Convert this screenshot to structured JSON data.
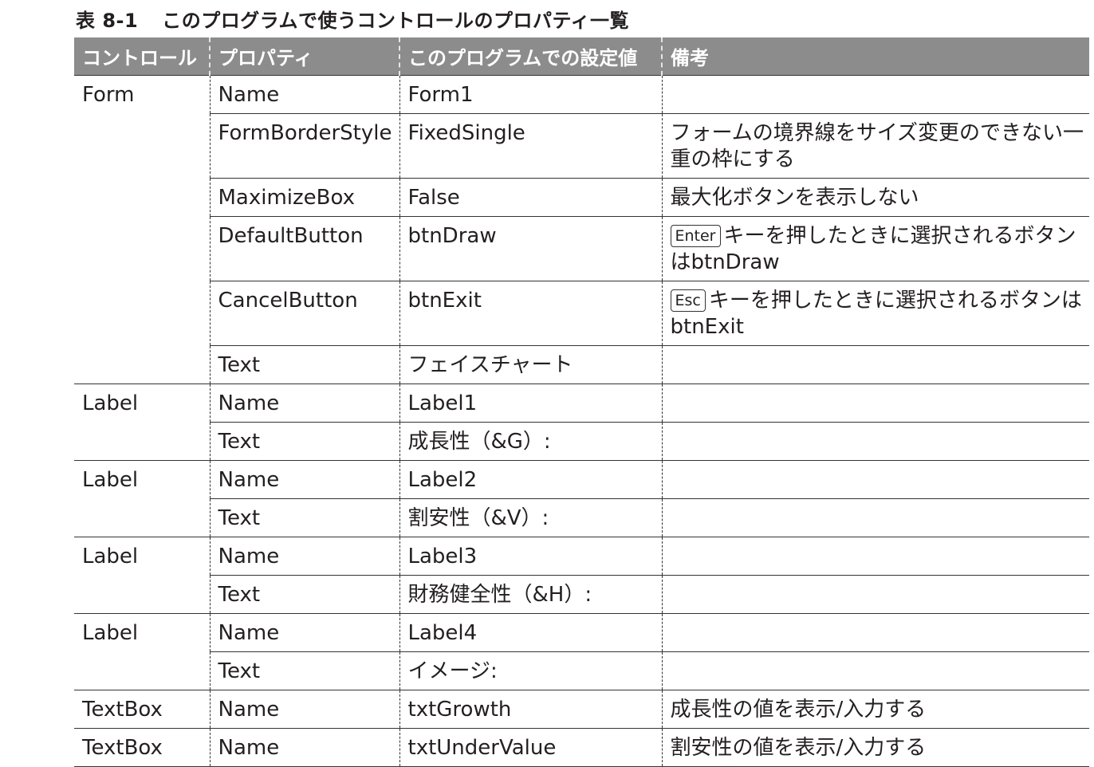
{
  "caption": {
    "number": "表 8-1",
    "title": "このプログラムで使うコントロールのプロパティ一覧"
  },
  "headers": [
    "コントロール",
    "プロパティ",
    "このプログラムでの設定値",
    "備考"
  ],
  "form": {
    "control": "Form",
    "rows": [
      {
        "property": "Name",
        "value": "Form1",
        "note": ""
      },
      {
        "property": "FormBorderStyle",
        "value": "FixedSingle",
        "note": "フォームの境界線をサイズ変更のできない一重の枠にする"
      },
      {
        "property": "MaximizeBox",
        "value": "False",
        "note": "最大化ボタンを表示しない"
      },
      {
        "property": "DefaultButton",
        "value": "btnDraw",
        "key": "Enter",
        "note": "キーを押したときに選択されるボタンはbtnDraw"
      },
      {
        "property": "CancelButton",
        "value": "btnExit",
        "key": "Esc",
        "note": "キーを押したときに選択されるボタンはbtnExit"
      },
      {
        "property": "Text",
        "value": "フェイスチャート",
        "note": ""
      }
    ]
  },
  "label1": {
    "control": "Label",
    "rows": [
      {
        "property": "Name",
        "value": "Label1"
      },
      {
        "property": "Text",
        "value": "成長性（&G）:"
      }
    ]
  },
  "label2": {
    "control": "Label",
    "rows": [
      {
        "property": "Name",
        "value": "Label2"
      },
      {
        "property": "Text",
        "value": "割安性（&V）:"
      }
    ]
  },
  "label3": {
    "control": "Label",
    "rows": [
      {
        "property": "Name",
        "value": "Label3"
      },
      {
        "property": "Text",
        "value": "財務健全性（&H）:"
      }
    ]
  },
  "label4": {
    "control": "Label",
    "rows": [
      {
        "property": "Name",
        "value": "Label4"
      },
      {
        "property": "Text",
        "value": "イメージ:"
      }
    ]
  },
  "textbox1": {
    "control": "TextBox",
    "property": "Name",
    "value": "txtGrowth",
    "note": "成長性の値を表示/入力する"
  },
  "textbox2": {
    "control": "TextBox",
    "property": "Name",
    "value": "txtUnderValue",
    "note": "割安性の値を表示/入力する"
  }
}
